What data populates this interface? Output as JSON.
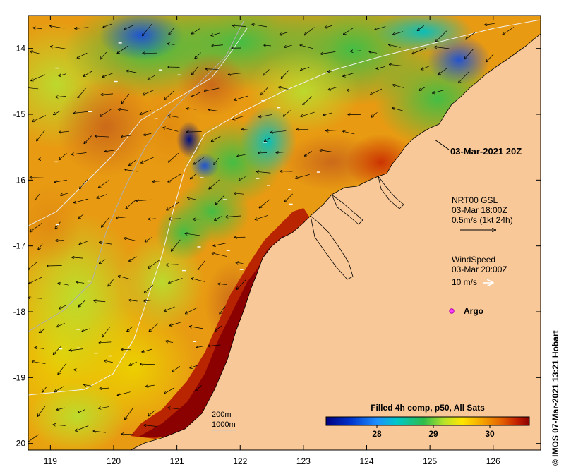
{
  "map": {
    "x_ticks": [
      "119",
      "120",
      "121",
      "122",
      "123",
      "124",
      "125",
      "126"
    ],
    "y_ticks": [
      "-14",
      "-15",
      "-16",
      "-17",
      "-18",
      "-19",
      "-20"
    ],
    "lon_range": [
      118.65,
      126.75
    ],
    "lat_range": [
      -20.1,
      -13.5
    ],
    "land_color": "#f9c898"
  },
  "annotations": {
    "timestamp": "03-Mar-2021 20Z",
    "current_title": "NRT00 GSL",
    "current_time": "03-Mar 18:00Z",
    "current_scale": "0.5m/s (1kt 24h)",
    "wind_title": "WindSpeed",
    "wind_time": "03-Mar 20:00Z",
    "wind_scale": "10 m/s",
    "argo_label": "Argo",
    "isobath_200": "200m",
    "isobath_1000": "1000m"
  },
  "colorbar": {
    "title": "Filled 4h comp, p50, All Sats",
    "ticks": [
      "28",
      "29",
      "30"
    ],
    "tick_values": [
      28,
      29,
      30
    ],
    "range": [
      27.1,
      30.7
    ]
  },
  "credit": "IMOS 07-Mar-2021 13:21 Hobart",
  "credit_icon": "copyright-icon"
}
